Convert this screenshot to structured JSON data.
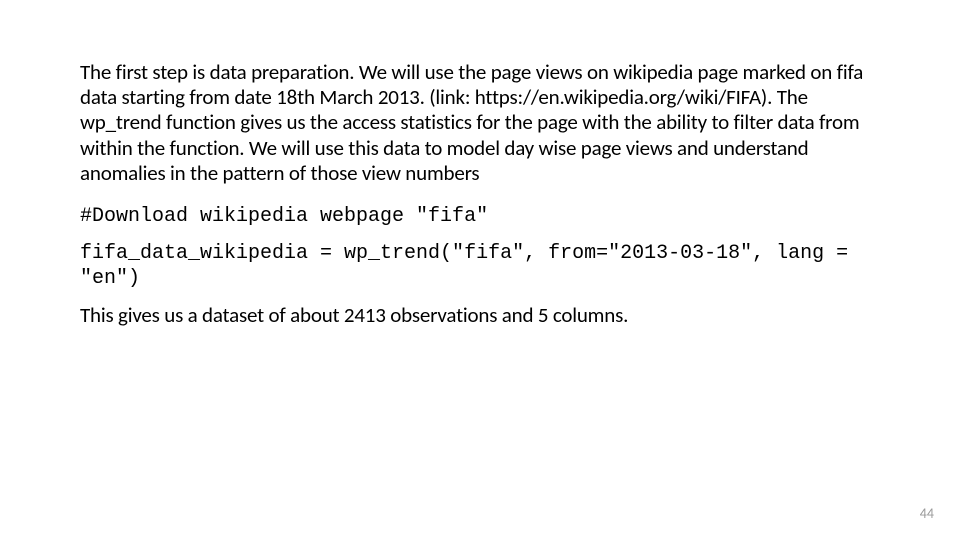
{
  "body": {
    "paragraph": "The first step is data preparation. We will use the page views on wikipedia page marked on fifa data starting from date 18th March 2013. (link: https://en.wikipedia.org/wiki/FIFA). The wp_trend function gives us the access statistics for the page with the ability to filter data from within the function. We will use this data to model day wise page views and understand anomalies in the pattern of those view numbers",
    "code_comment": "#Download wikipedia webpage \"fifa\"",
    "code_line": "fifa_data_wikipedia = wp_trend(\"fifa\", from=\"2013-03-18\", lang = \"en\")",
    "result": "This gives us a dataset of about 2413 observations and 5 columns."
  },
  "page_number": "44"
}
